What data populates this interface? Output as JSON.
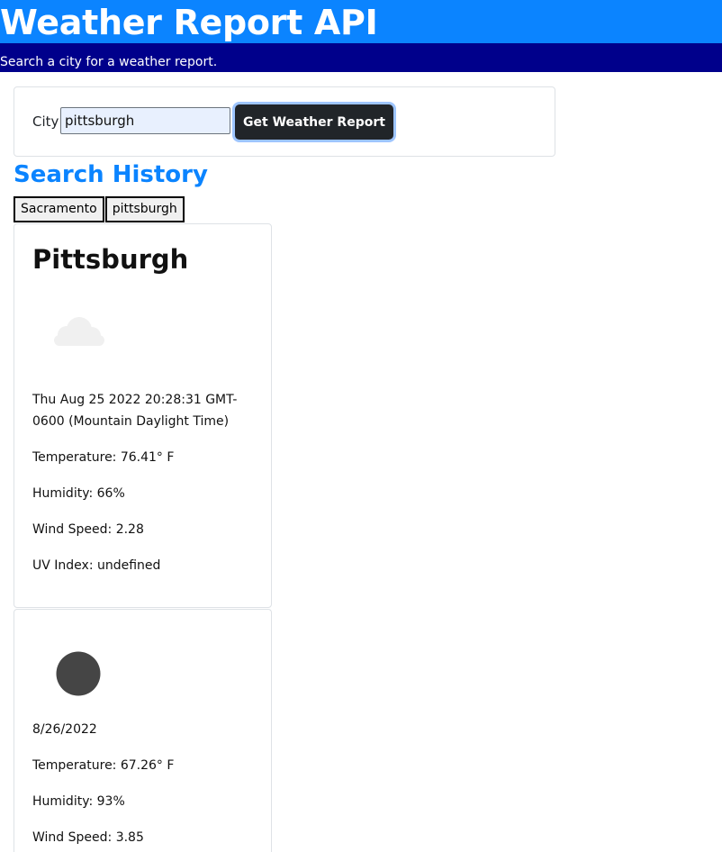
{
  "header": {
    "title": "Weather Report API",
    "subtitle": "Search a city for a weather report."
  },
  "search": {
    "label": "City",
    "value": "pittsburgh",
    "button_label": "Get Weather Report"
  },
  "history": {
    "title": "Search History",
    "items": [
      "Sacramento",
      "pittsburgh"
    ]
  },
  "current": {
    "city": "Pittsburgh",
    "icon": "cloud-icon",
    "date": "Thu Aug 25 2022 20:28:31 GMT-0600 (Mountain Daylight Time)",
    "temperature": "Temperature: 76.41° F",
    "humidity": "Humidity: 66%",
    "wind": "Wind Speed: 2.28",
    "uv": "UV Index: undefined"
  },
  "forecast": [
    {
      "icon": "dark-circle-icon",
      "date": "8/26/2022",
      "temperature": "Temperature: 67.26° F",
      "humidity": "Humidity: 93%",
      "wind": "Wind Speed: 3.85"
    }
  ],
  "colors": {
    "header_bg": "#0b84ff",
    "subheader_bg": "#00008b",
    "accent": "#0b84ff",
    "button_bg": "#212529"
  }
}
